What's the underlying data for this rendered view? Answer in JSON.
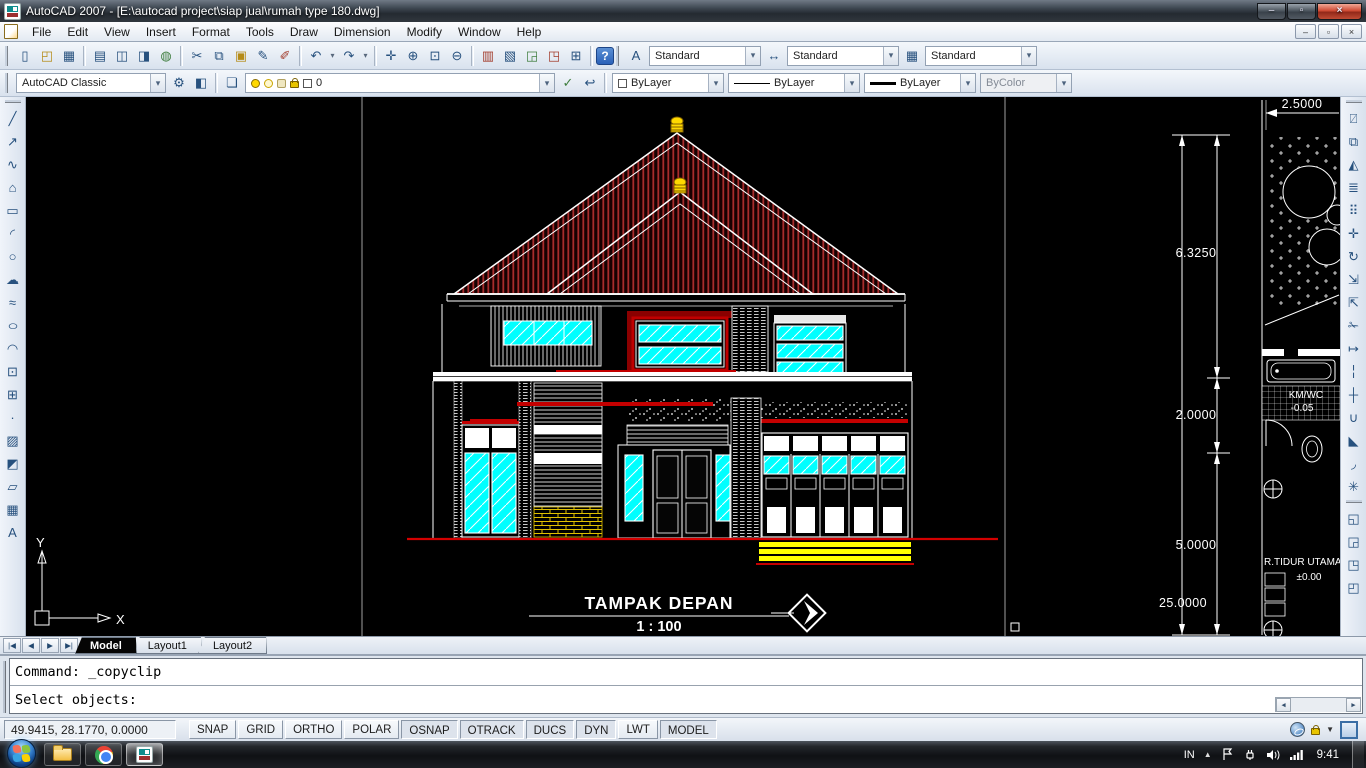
{
  "window": {
    "title": "AutoCAD 2007 - [E:\\autocad project\\siap jual\\rumah type 180.dwg]"
  },
  "menu": {
    "items": [
      "File",
      "Edit",
      "View",
      "Insert",
      "Format",
      "Tools",
      "Draw",
      "Dimension",
      "Modify",
      "Window",
      "Help"
    ]
  },
  "toolbars": {
    "text_style": "Standard",
    "dim_style": "Standard",
    "table_style": "Standard",
    "workspace": "AutoCAD Classic",
    "layer_name": "0",
    "color": "ByLayer",
    "linetype": "ByLayer",
    "lineweight": "ByLayer",
    "plot_style": "ByColor"
  },
  "icons": {
    "caret": "▾",
    "std": [
      "▯",
      "◰",
      "▦",
      "▤",
      "◫",
      "◨",
      "◍",
      "✂",
      "⧉",
      "▣",
      "✎",
      "✐",
      "↶",
      "↷",
      "✛",
      "⊕",
      "⊡",
      "⊖",
      "▥",
      "▧",
      "◲",
      "◳",
      "⊞",
      "?"
    ],
    "styles": [
      "A",
      "↔",
      "▦"
    ],
    "workspace_extra": [
      "⚙",
      "◧"
    ],
    "layers": [
      "❏",
      "✓",
      "↩"
    ],
    "draw": [
      "╱",
      "↗",
      "∿",
      "⌂",
      "▭",
      "◜",
      "○",
      "☁",
      "≈",
      "○",
      "◠",
      "⊡",
      "⊞",
      "·",
      "▨",
      "◩",
      "▱",
      "▦",
      "A"
    ],
    "modify": [
      "⍁",
      "⧉",
      "◭",
      "≣",
      "⠿",
      "✛",
      "↻",
      "⇲",
      "⇱",
      "✁",
      "↦",
      "╎",
      "┼",
      "∪",
      "◣",
      "◞",
      "✳"
    ],
    "draworder": [
      "◱",
      "◲",
      "◳",
      "◰"
    ],
    "tabnav": [
      "|◀",
      "◀",
      "▶",
      "▶|"
    ],
    "cmd_scroll_left": "◀",
    "cmd_scroll_right": "▶",
    "tray_caret": "▲",
    "status_caret": "▼",
    "win": [
      "–",
      "▫",
      "×"
    ]
  },
  "drawing": {
    "title": "TAMPAK DEPAN",
    "scale": "1 : 100",
    "dims": {
      "top": "2.5000",
      "upper": "6.3250",
      "middle": "2.0000",
      "lower": "5.0000",
      "total": "25.0000"
    },
    "plan": {
      "bath": "KM/WC",
      "bath_level": "-0.05",
      "bed": "R.TIDUR UTAMA",
      "bed_level": "±0.00"
    },
    "ucs": {
      "x": "X",
      "y": "Y"
    }
  },
  "tabs": {
    "model": "Model",
    "layout1": "Layout1",
    "layout2": "Layout2"
  },
  "command": {
    "history": "Command: _copyclip",
    "prompt": "Select objects:"
  },
  "statusbar": {
    "coordinates": "49.9415, 28.1770, 0.0000",
    "toggles": [
      {
        "label": "SNAP",
        "on": false
      },
      {
        "label": "GRID",
        "on": false
      },
      {
        "label": "ORTHO",
        "on": false
      },
      {
        "label": "POLAR",
        "on": false
      },
      {
        "label": "OSNAP",
        "on": true
      },
      {
        "label": "OTRACK",
        "on": true
      },
      {
        "label": "DUCS",
        "on": true
      },
      {
        "label": "DYN",
        "on": true
      },
      {
        "label": "LWT",
        "on": false
      },
      {
        "label": "MODEL",
        "on": true
      }
    ]
  },
  "taskbar": {
    "language": "IN",
    "time": "9:41"
  },
  "colors": {
    "glass": "#00ffff",
    "roof": "#a82c2c",
    "accent_red": "#d40000",
    "steps_yellow": "#ffff00",
    "finial_yellow": "#ffd900",
    "canvas": "#000000"
  }
}
